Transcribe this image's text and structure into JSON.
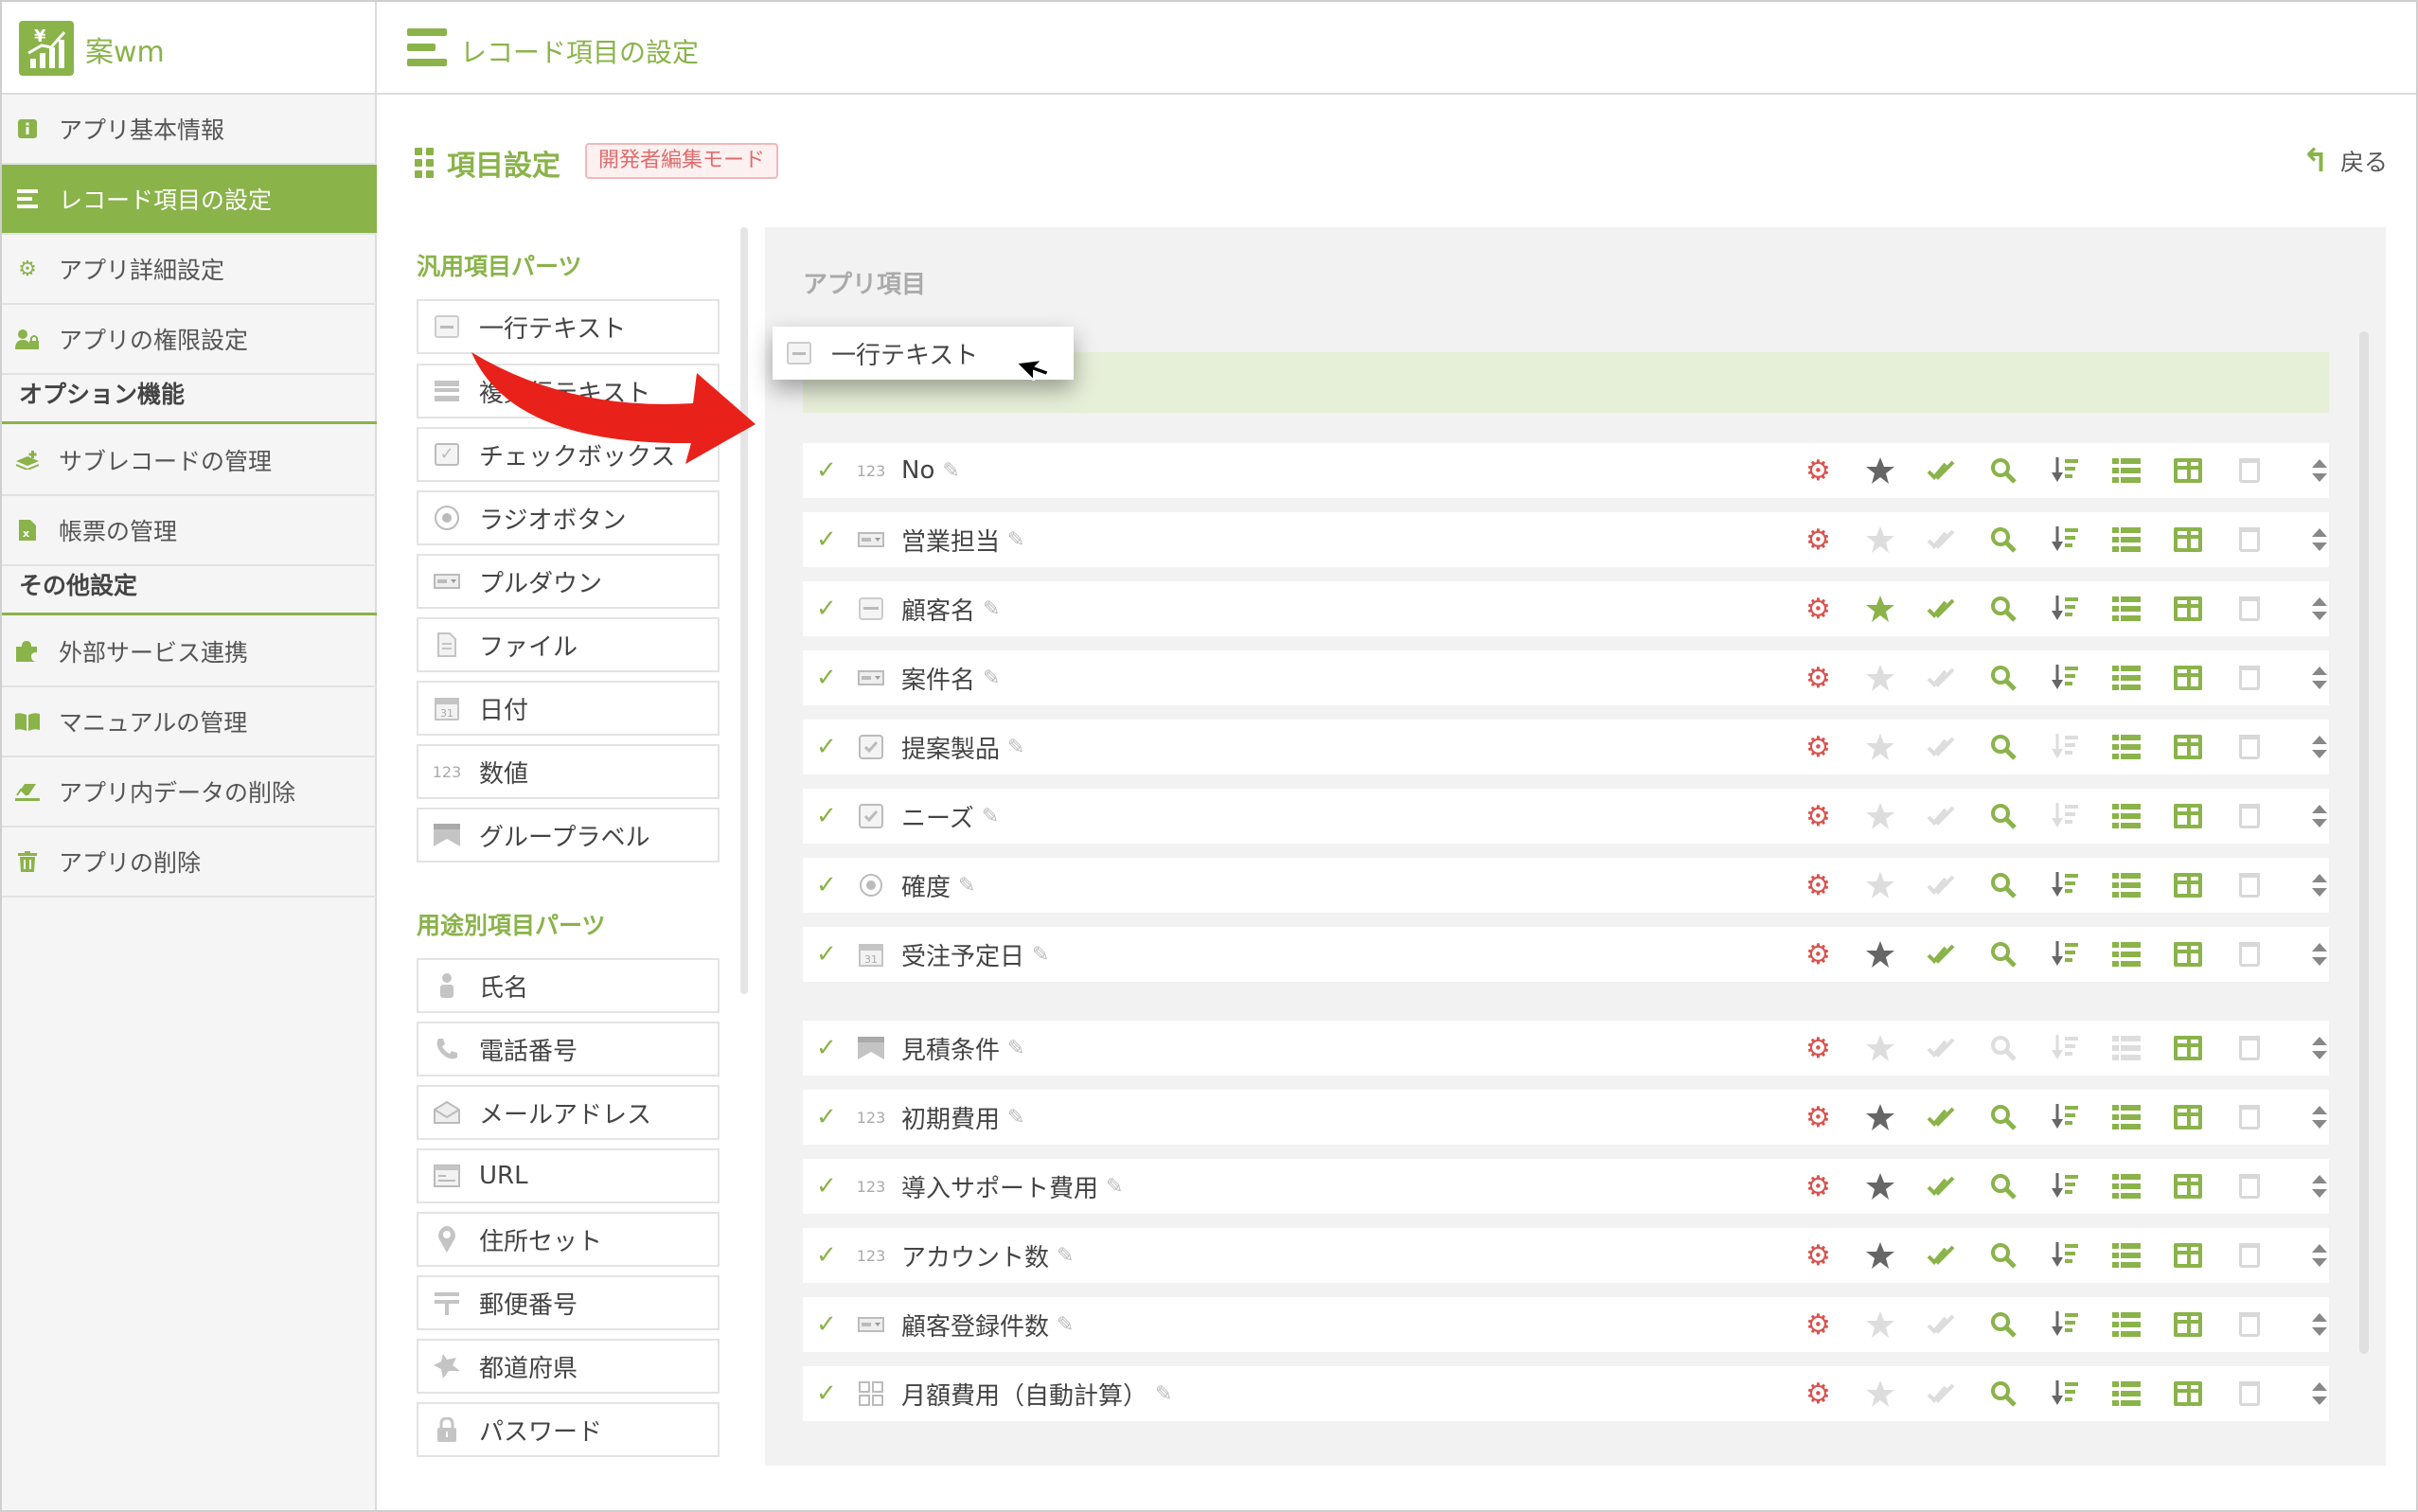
{
  "app": {
    "logo_text": "案wm",
    "logo_glyph": "¥",
    "page_title": "レコード項目の設定"
  },
  "sidebar": {
    "items": [
      {
        "label": "アプリ基本情報",
        "icon": "info-icon"
      },
      {
        "label": "レコード項目の設定",
        "icon": "list-icon",
        "active": true
      },
      {
        "label": "アプリ詳細設定",
        "icon": "gear-icon"
      },
      {
        "label": "アプリの権限設定",
        "icon": "user-lock-icon"
      }
    ],
    "option_heading": "オプション機能",
    "option_items": [
      {
        "label": "サブレコードの管理",
        "icon": "layers-icon"
      },
      {
        "label": "帳票の管理",
        "icon": "excel-icon"
      }
    ],
    "other_heading": "その他設定",
    "other_items": [
      {
        "label": "外部サービス連携",
        "icon": "puzzle-icon"
      },
      {
        "label": "マニュアルの管理",
        "icon": "book-icon"
      },
      {
        "label": "アプリ内データの削除",
        "icon": "eraser-icon"
      },
      {
        "label": "アプリの削除",
        "icon": "trash-icon"
      }
    ]
  },
  "main": {
    "section_title": "項目設定",
    "dev_mode_badge": "開発者編集モード",
    "back_label": "戻る",
    "general_parts_heading": "汎用項目パーツ",
    "general_parts": [
      {
        "label": "一行テキスト",
        "icon": "single-line-icon"
      },
      {
        "label": "複数行テキスト",
        "icon": "multi-line-icon"
      },
      {
        "label": "チェックボックス",
        "icon": "checkbox-icon"
      },
      {
        "label": "ラジオボタン",
        "icon": "radio-icon"
      },
      {
        "label": "プルダウン",
        "icon": "dropdown-icon"
      },
      {
        "label": "ファイル",
        "icon": "file-icon"
      },
      {
        "label": "日付",
        "icon": "calendar-icon"
      },
      {
        "label": "数値",
        "icon": "number-icon"
      },
      {
        "label": "グループラベル",
        "icon": "group-label-icon"
      }
    ],
    "purpose_parts_heading": "用途別項目パーツ",
    "purpose_parts": [
      {
        "label": "氏名",
        "icon": "person-icon"
      },
      {
        "label": "電話番号",
        "icon": "phone-icon"
      },
      {
        "label": "メールアドレス",
        "icon": "mail-icon"
      },
      {
        "label": "URL",
        "icon": "url-icon"
      },
      {
        "label": "住所セット",
        "icon": "map-pin-icon"
      },
      {
        "label": "郵便番号",
        "icon": "postal-icon"
      },
      {
        "label": "都道府県",
        "icon": "prefecture-icon"
      },
      {
        "label": "パスワード",
        "icon": "lock-icon"
      }
    ],
    "app_items_heading": "アプリ項目",
    "dragged_item": "一行テキスト",
    "number_glyph": "123",
    "calendar_glyph": "31",
    "fields": [
      {
        "name": "No",
        "type": "number",
        "star": "dark",
        "multi": "green",
        "search": "green",
        "sort": "dark",
        "list": "green"
      },
      {
        "name": "営業担当",
        "type": "dropdown",
        "star": "light",
        "multi": "light",
        "search": "green",
        "sort": "dark",
        "list": "green"
      },
      {
        "name": "顧客名",
        "type": "single",
        "star": "green",
        "multi": "green",
        "search": "green",
        "sort": "dark",
        "list": "green"
      },
      {
        "name": "案件名",
        "type": "dropdown",
        "star": "light",
        "multi": "light",
        "search": "green",
        "sort": "dark",
        "list": "green"
      },
      {
        "name": "提案製品",
        "type": "checkbox",
        "star": "light",
        "multi": "light",
        "search": "green",
        "sort": "light",
        "list": "green"
      },
      {
        "name": "ニーズ",
        "type": "checkbox",
        "star": "light",
        "multi": "light",
        "search": "green",
        "sort": "light",
        "list": "green"
      },
      {
        "name": "確度",
        "type": "radio",
        "star": "light",
        "multi": "light",
        "search": "green",
        "sort": "dark",
        "list": "green"
      },
      {
        "name": "受注予定日",
        "type": "date",
        "star": "dark",
        "multi": "green",
        "search": "green",
        "sort": "dark",
        "list": "green"
      },
      {
        "name": "見積条件",
        "type": "group",
        "star": "light",
        "multi": "light",
        "search": "light",
        "sort": "light",
        "list": "light"
      },
      {
        "name": "初期費用",
        "type": "number",
        "star": "dark",
        "multi": "green",
        "search": "green",
        "sort": "dark",
        "list": "green"
      },
      {
        "name": "導入サポート費用",
        "type": "number",
        "star": "dark",
        "multi": "green",
        "search": "green",
        "sort": "dark",
        "list": "green"
      },
      {
        "name": "アカウント数",
        "type": "number",
        "star": "dark",
        "multi": "green",
        "search": "green",
        "sort": "dark",
        "list": "green"
      },
      {
        "name": "顧客登録件数",
        "type": "dropdown",
        "star": "light",
        "multi": "light",
        "search": "green",
        "sort": "dark",
        "list": "green"
      },
      {
        "name": "月額費用（自動計算）",
        "type": "calc",
        "star": "light",
        "multi": "light",
        "search": "green",
        "sort": "dark",
        "list": "green"
      }
    ]
  },
  "colors": {
    "accent": "#8ab34a",
    "gear": "#d9534f",
    "star_dark": "#666666",
    "disabled": "#dddddd",
    "drop_zone": "#e6efd8",
    "badge_text": "#e06c6c"
  }
}
